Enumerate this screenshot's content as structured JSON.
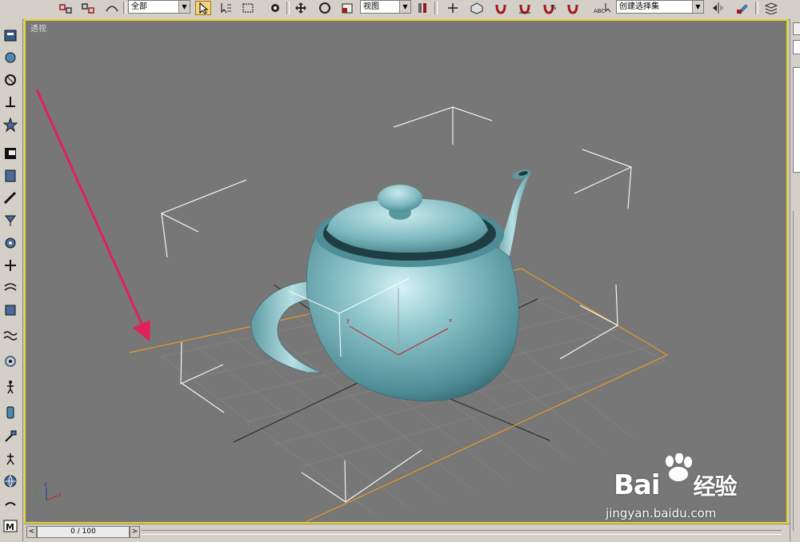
{
  "toolbar": {
    "selection_filter": "全部",
    "reference_coord": "视图",
    "named_selection": "创建选择集"
  },
  "viewport": {
    "label": "透视",
    "gizmo_axes": {
      "z": "z",
      "x": "x",
      "y": "y"
    },
    "corner_axes": {
      "z": "z",
      "x": "x",
      "y": "y"
    },
    "highlight_color": "#e8d42a",
    "object_color": "#6fb0b8",
    "grid_outline_color": "#e89a2a",
    "annotation_arrow_color": "#e0205a"
  },
  "timeline": {
    "frame_display": "0 / 100",
    "prev_label": "<",
    "next_label": ">"
  },
  "watermark": {
    "brand": "Bai",
    "brand_suffix": "经验",
    "url": "jingyan.baidu.com"
  }
}
